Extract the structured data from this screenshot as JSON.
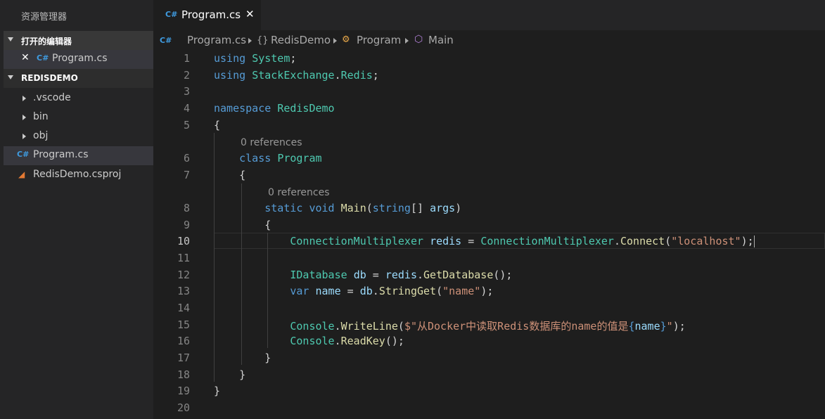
{
  "sidebar": {
    "title": "资源管理器",
    "open_editors": {
      "header": "打开的编辑器",
      "items": [
        {
          "name": "Program.cs",
          "icon": "csharp-icon"
        }
      ]
    },
    "project": {
      "header": "REDISDEMO",
      "items": [
        {
          "name": ".vscode",
          "type": "folder"
        },
        {
          "name": "bin",
          "type": "folder"
        },
        {
          "name": "obj",
          "type": "folder"
        },
        {
          "name": "Program.cs",
          "type": "file",
          "icon": "csharp-icon"
        },
        {
          "name": "RedisDemo.csproj",
          "type": "file",
          "icon": "rss-icon"
        }
      ]
    }
  },
  "tab": {
    "label": "Program.cs",
    "close": "✕"
  },
  "breadcrumb": {
    "file": "Program.cs",
    "namespace_icon": "{}",
    "namespace": "RedisDemo",
    "class": "Program",
    "method": "Main"
  },
  "editor": {
    "active_line": 10,
    "code_lens": "0 references",
    "line_numbers": [
      "1",
      "2",
      "3",
      "4",
      "5",
      "6",
      "7",
      "8",
      "9",
      "10",
      "11",
      "12",
      "13",
      "14",
      "15",
      "16",
      "17",
      "18",
      "19",
      "20"
    ],
    "tokens": {
      "using": "using",
      "System": "System",
      "StackExchange": "StackExchange",
      "Redis": "Redis",
      "namespace": "namespace",
      "RedisDemo": "RedisDemo",
      "class": "class",
      "Program": "Program",
      "static": "static",
      "void": "void",
      "Main": "Main",
      "string": "string",
      "args": "args",
      "ConnectionMultiplexer": "ConnectionMultiplexer",
      "redis": "redis",
      "Connect": "Connect",
      "localhost": "\"localhost\"",
      "IDatabase": "IDatabase",
      "db": "db",
      "GetDatabase": "GetDatabase",
      "var": "var",
      "name": "name",
      "StringGet": "StringGet",
      "name_str": "\"name\"",
      "Console": "Console",
      "WriteLine": "WriteLine",
      "interp_start": "$\"从Docker中读取Redis数据库的name的值是",
      "interp_end": "\"",
      "ReadKey": "ReadKey"
    }
  },
  "colors": {
    "background": "#1e1e1e",
    "sidebar": "#252526",
    "keyword": "#569cd6",
    "type": "#4ec9b0",
    "function": "#dcdcaa",
    "variable": "#9cdcfe",
    "string": "#ce9178"
  }
}
